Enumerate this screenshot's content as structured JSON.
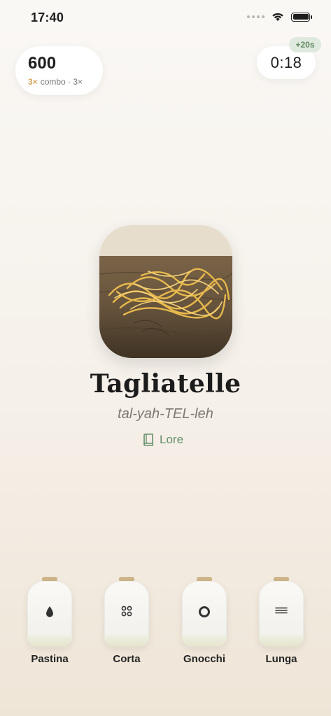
{
  "status_bar": {
    "time": "17:40"
  },
  "score": {
    "value": "600",
    "combo_multiplier": "3×",
    "combo_text": "combo · 3×"
  },
  "timer": {
    "value": "0:18",
    "bonus": "+20s"
  },
  "pasta": {
    "name": "Tagliatelle",
    "pronunciation": "tal-yah-TEL-leh",
    "lore_label": "Lore"
  },
  "jars": [
    {
      "label": "Pastina",
      "icon": "drop-icon"
    },
    {
      "label": "Corta",
      "icon": "four-rings-icon"
    },
    {
      "label": "Gnocchi",
      "icon": "ring-icon"
    },
    {
      "label": "Lunga",
      "icon": "lines-icon"
    }
  ],
  "colors": {
    "accent_green": "#668f6a",
    "combo_gold": "#d6a45c",
    "lid": "#ceb58a"
  }
}
